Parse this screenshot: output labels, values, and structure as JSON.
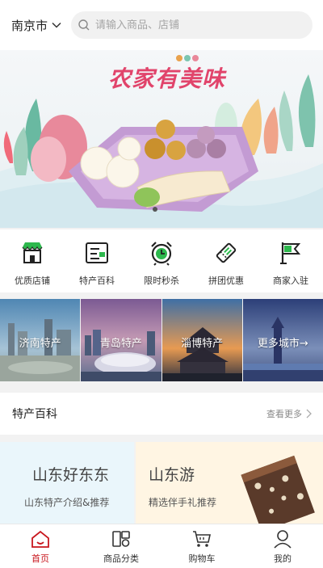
{
  "header": {
    "city": "南京市",
    "search_placeholder": "请输入商品、店铺"
  },
  "banner": {
    "title": "农家有美味",
    "dot_count": 1
  },
  "quicknav": [
    {
      "label": "优质店铺",
      "icon": "store-icon"
    },
    {
      "label": "特产百科",
      "icon": "encyclopedia-icon"
    },
    {
      "label": "限时秒杀",
      "icon": "alarm-clock-icon"
    },
    {
      "label": "拼团优惠",
      "icon": "coupon-icon"
    },
    {
      "label": "商家入驻",
      "icon": "flag-icon"
    }
  ],
  "cities": [
    {
      "label": "济南特产"
    },
    {
      "label": "青岛特产"
    },
    {
      "label": "淄博特产"
    },
    {
      "label": "更多城市→"
    }
  ],
  "section": {
    "title": "特产百科",
    "more": "查看更多"
  },
  "promos": [
    {
      "title": "山东好东东",
      "subtitle": "山东特产介绍&推荐"
    },
    {
      "title": "山东游",
      "subtitle": "精选伴手礼推荐"
    }
  ],
  "tabbar": [
    {
      "label": "首页",
      "icon": "home-icon",
      "active": true
    },
    {
      "label": "商品分类",
      "icon": "category-icon",
      "active": false
    },
    {
      "label": "购物车",
      "icon": "cart-icon",
      "active": false
    },
    {
      "label": "我的",
      "icon": "user-icon",
      "active": false
    }
  ],
  "colors": {
    "accent": "#c8161d",
    "icon_green": "#2db84d",
    "banner_title": "#e1446b"
  }
}
